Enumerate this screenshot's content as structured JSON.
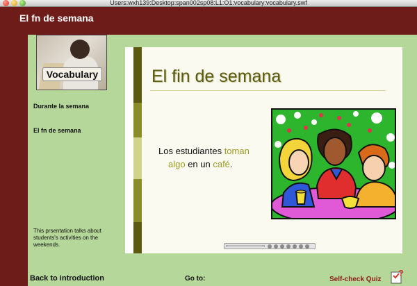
{
  "window": {
    "title": "Users:wxh139:Desktop:span002sp08:L1:O1:vocabulary:vocabulary.swf"
  },
  "header": {
    "module_title": "El fn de semana"
  },
  "sidebar": {
    "photo_label": "Vocabulary",
    "items": [
      {
        "label": "Durante la semana"
      },
      {
        "label": "El fn de semana"
      }
    ],
    "description": "This prsentation talks about students's activities on the weekends."
  },
  "slide": {
    "title": "El fin de semana",
    "sentence": {
      "part1": "Los estudiantes ",
      "word1": "toman",
      "word2": "algo",
      "part2": " en un ",
      "word3": "café",
      "part3": "."
    }
  },
  "footer": {
    "back_label": "Back to introduction",
    "goto_label": "Go to:",
    "quiz_label": "Self-check Quiz"
  },
  "colors": {
    "frame": "#6e1c1a",
    "background": "#b5d79a",
    "accent": "#9a9a22",
    "slide_title": "#5c5a10",
    "quiz": "#8b1a17"
  }
}
